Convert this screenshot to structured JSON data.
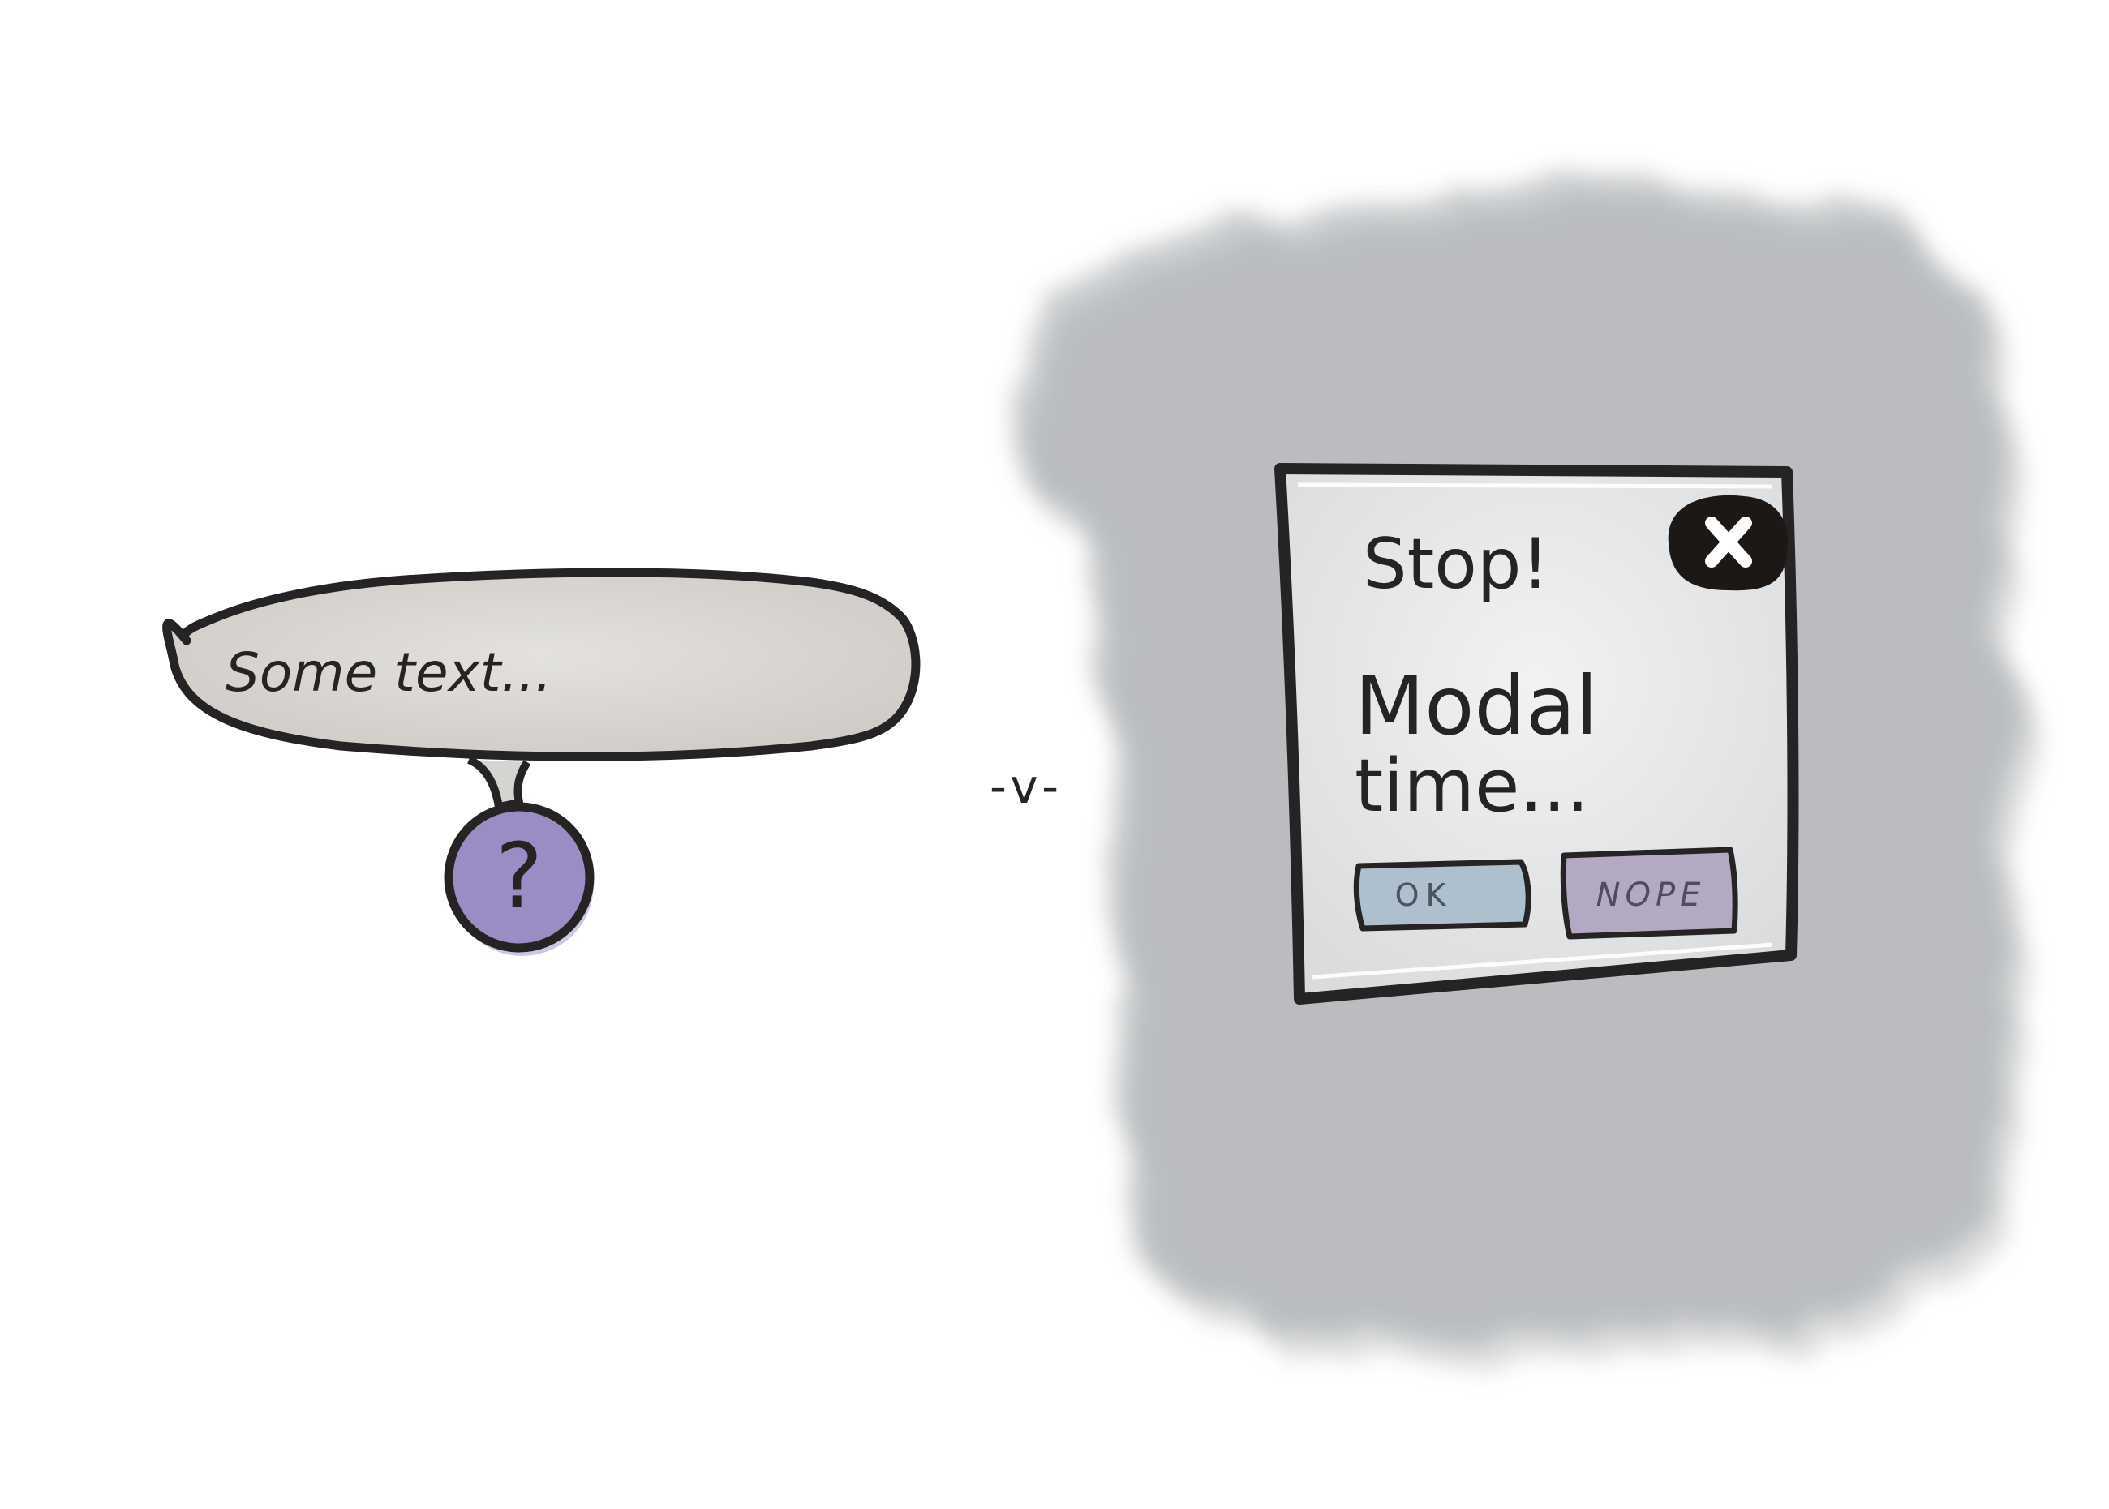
{
  "tooltip": {
    "bubble_text": "Some text...",
    "help_icon_glyph": "?"
  },
  "separator": {
    "text": "-v-"
  },
  "modal": {
    "title": "Stop!",
    "body": [
      "Modal",
      "time..."
    ],
    "close_glyph": "✕",
    "ok_label": "OK",
    "nope_label": "NOPE"
  },
  "colors": {
    "ink": "#262325",
    "bubble_fill": "#d8d6d2",
    "help_fill": "#9b8cc4",
    "overlay": "#a7aaac",
    "modal_fill": "#e9eaeb",
    "ok_fill": "#aebfce",
    "nope_fill": "#b3a9c2"
  }
}
